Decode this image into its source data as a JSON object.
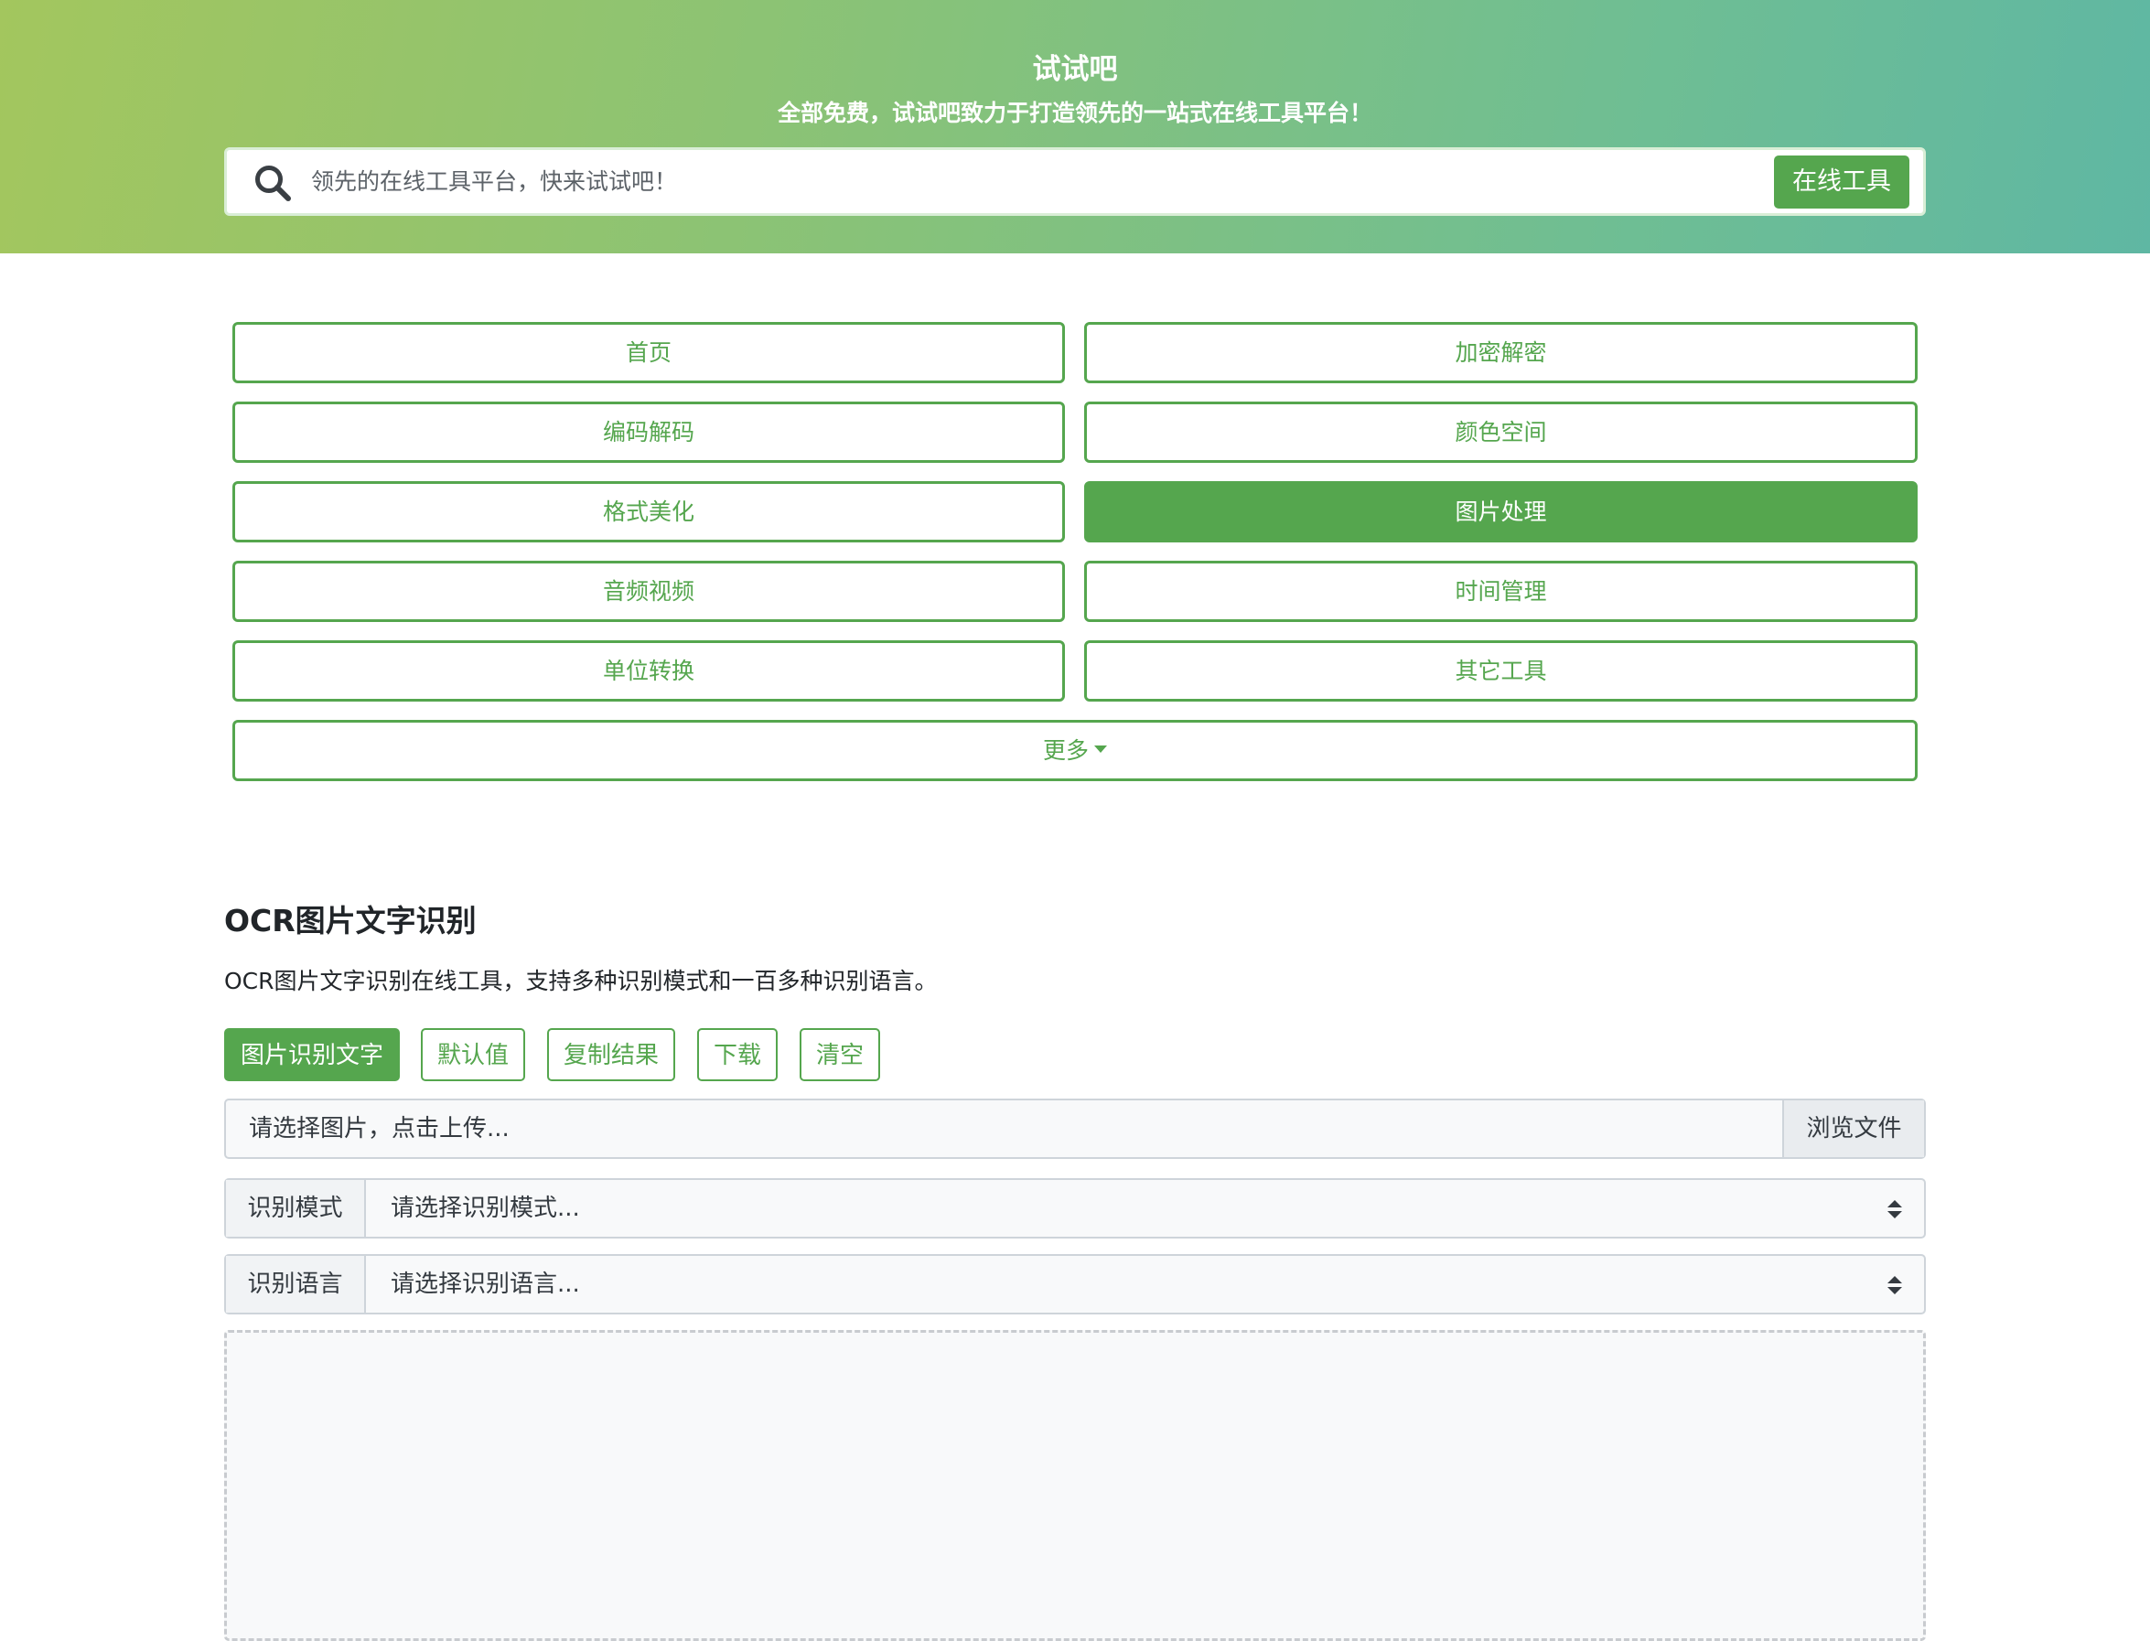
{
  "header": {
    "title": "试试吧",
    "subtitle": "全部免费，试试吧致力于打造领先的一站式在线工具平台！",
    "search_placeholder": "领先的在线工具平台，快来试试吧！",
    "search_button": "在线工具"
  },
  "categories": [
    {
      "label": "首页",
      "active": false
    },
    {
      "label": "加密解密",
      "active": false
    },
    {
      "label": "编码解码",
      "active": false
    },
    {
      "label": "颜色空间",
      "active": false
    },
    {
      "label": "格式美化",
      "active": false
    },
    {
      "label": "图片处理",
      "active": true
    },
    {
      "label": "音频视频",
      "active": false
    },
    {
      "label": "时间管理",
      "active": false
    },
    {
      "label": "单位转换",
      "active": false
    },
    {
      "label": "其它工具",
      "active": false
    }
  ],
  "more_label": "更多",
  "tool": {
    "title": "OCR图片文字识别",
    "description": "OCR图片文字识别在线工具，支持多种识别模式和一百多种识别语言。"
  },
  "actions": {
    "recognize": "图片识别文字",
    "defaults": "默认值",
    "copy": "复制结果",
    "download": "下载",
    "clear": "清空"
  },
  "file_input": {
    "placeholder": "请选择图片，点击上传...",
    "browse": "浏览文件"
  },
  "mode_select": {
    "label": "识别模式",
    "value": "请选择识别模式..."
  },
  "language_select": {
    "label": "识别语言",
    "value": "请选择识别语言..."
  },
  "colors": {
    "accent": "#55a64e",
    "gradient_start": "#a3c65e",
    "gradient_end": "#5fb7a3"
  }
}
